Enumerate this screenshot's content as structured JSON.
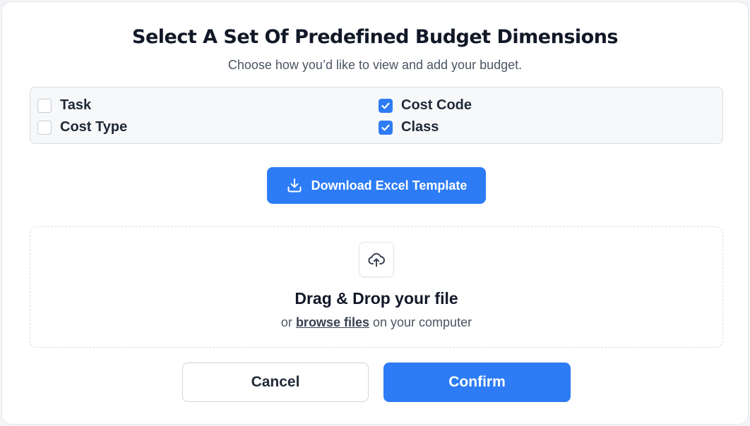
{
  "dialog": {
    "title": "Select A Set Of Predefined Budget Dimensions",
    "subtitle": "Choose how you’d like to view and add your budget."
  },
  "dimensions": [
    {
      "label": "Task",
      "checked": false
    },
    {
      "label": "Cost Type",
      "checked": false
    },
    {
      "label": "Cost Code",
      "checked": true
    },
    {
      "label": "Class",
      "checked": true
    }
  ],
  "download_button": {
    "label": "Download Excel Template",
    "icon": "download-icon"
  },
  "dropzone": {
    "icon": "cloud-upload-icon",
    "title": "Drag & Drop your file",
    "prefix": "or",
    "link": "browse files",
    "suffix": "on your computer"
  },
  "actions": {
    "cancel": "Cancel",
    "confirm": "Confirm"
  },
  "colors": {
    "accent": "#2d7cf6",
    "title": "#111827",
    "muted": "#4b5563"
  }
}
